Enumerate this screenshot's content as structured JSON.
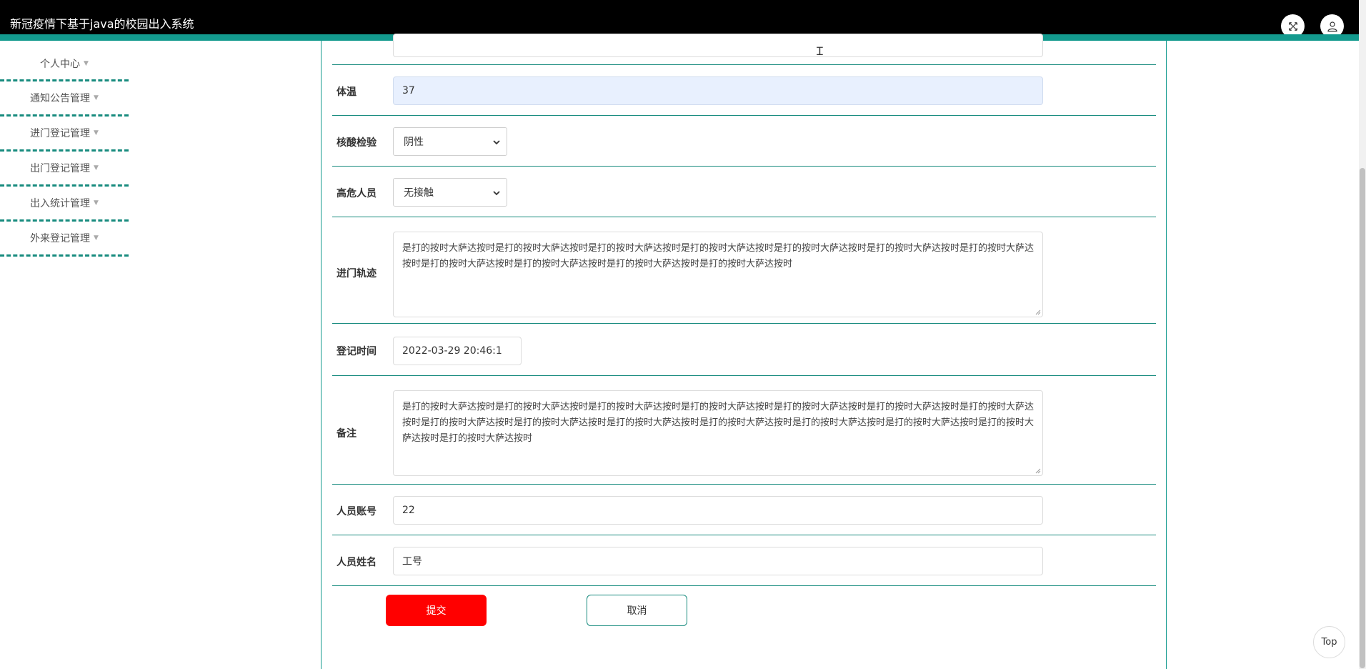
{
  "header": {
    "title": "新冠疫情下基于java的校园出入系统",
    "fullscreen_icon": "fullscreen-icon",
    "user_icon": "user-icon",
    "accent_color": "#139a8e"
  },
  "sidebar": {
    "items": [
      {
        "label": "个人中心"
      },
      {
        "label": "通知公告管理"
      },
      {
        "label": "进门登记管理"
      },
      {
        "label": "出门登记管理"
      },
      {
        "label": "出入统计管理"
      },
      {
        "label": "外来登记管理"
      }
    ]
  },
  "form": {
    "temperature": {
      "label": "体温",
      "value": "37"
    },
    "nucleic_test": {
      "label": "核酸检验",
      "value": "阴性"
    },
    "high_risk": {
      "label": "高危人员",
      "value": "无接触"
    },
    "entry_track": {
      "label": "进门轨迹",
      "value": "是打的按时大萨达按时是打的按时大萨达按时是打的按时大萨达按时是打的按时大萨达按时是打的按时大萨达按时是打的按时大萨达按时是打的按时大萨达按时是打的按时大萨达按时是打的按时大萨达按时是打的按时大萨达按时是打的按时大萨达按时"
    },
    "register_time": {
      "label": "登记时间",
      "value": "2022-03-29 20:46:1"
    },
    "remark": {
      "label": "备注",
      "value": "是打的按时大萨达按时是打的按时大萨达按时是打的按时大萨达按时是打的按时大萨达按时是打的按时大萨达按时是打的按时大萨达按时是打的按时大萨达按时是打的按时大萨达按时是打的按时大萨达按时是打的按时大萨达按时是打的按时大萨达按时是打的按时大萨达按时是打的按时大萨达按时是打的按时大萨达按时是打的按时大萨达按时"
    },
    "account": {
      "label": "人员账号",
      "value": "22"
    },
    "name": {
      "label": "人员姓名",
      "value": "工号"
    },
    "submit_label": "提交",
    "cancel_label": "取消"
  },
  "back_to_top": "Top",
  "colors": {
    "submit": "#ff0000",
    "border": "#178b7e"
  }
}
